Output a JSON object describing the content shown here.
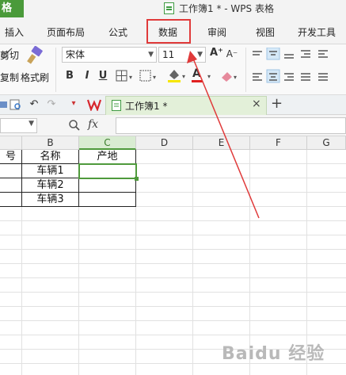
{
  "titlebar": {
    "app_label": "格",
    "title": "工作簿1 * - WPS 表格"
  },
  "menu": {
    "tabs": [
      "插入",
      "页面布局",
      "公式",
      "数据",
      "审阅",
      "视图",
      "开发工具"
    ],
    "highlighted": "数据"
  },
  "ribbon": {
    "cut_label": "剪切",
    "copy_label": "复制",
    "format_painter_label": "格式刷",
    "font_name": "宋体",
    "font_size": "11",
    "bold": "B",
    "italic": "I",
    "underline": "U",
    "grow_font": "A⁺",
    "shrink_font": "A⁻",
    "font_color_glyph": "A"
  },
  "quickbar": {
    "doc_tab_title": "工作簿1 *",
    "close_glyph": "×",
    "new_tab_glyph": "+"
  },
  "formula_bar": {
    "fx": "fx",
    "name_box_value": "",
    "formula_value": ""
  },
  "sheet": {
    "columns": [
      "B",
      "C",
      "D",
      "E",
      "F",
      "G"
    ],
    "partial_col_header": "",
    "selected_column": "C",
    "header_row": {
      "a_partial": "号",
      "b": "名称",
      "c": "产地"
    },
    "rows": [
      {
        "b": "车辆1",
        "c": ""
      },
      {
        "b": "车辆2",
        "c": ""
      },
      {
        "b": "车辆3",
        "c": ""
      }
    ]
  },
  "annotation": {
    "arrow_color": "#e03a3a",
    "box_color": "#e03a3a"
  },
  "colors": {
    "accent_green": "#4f9a3c",
    "app_green": "#4a9a3a",
    "annotation_red": "#e03a3a"
  },
  "watermark": "Baidu 经验"
}
